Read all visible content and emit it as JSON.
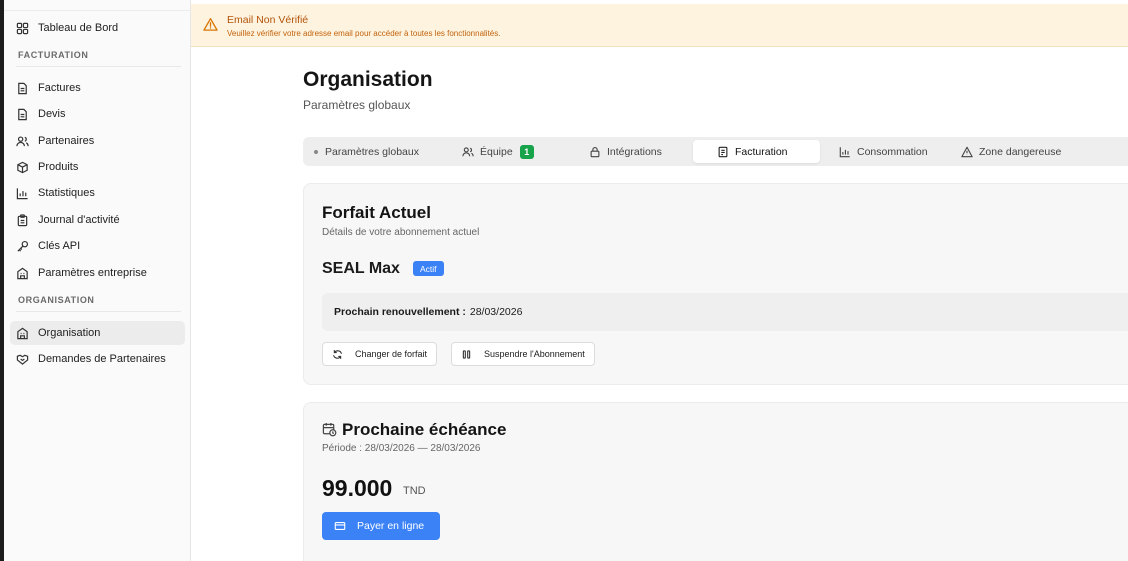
{
  "sidebar": {
    "dashboard": "Tableau de Bord",
    "section_billing": "FACTURATION",
    "items_billing": [
      "Factures",
      "Devis",
      "Partenaires",
      "Produits",
      "Statistiques",
      "Journal d'activité",
      "Clés API",
      "Paramètres entreprise"
    ],
    "section_org": "ORGANISATION",
    "items_org": [
      "Organisation",
      "Demandes de Partenaires"
    ],
    "active": "Organisation"
  },
  "banner": {
    "title": "Email Non Vérifié",
    "description": "Veuillez vérifier votre adresse email pour accéder à toutes les fonctionnalités.",
    "icon": "warning-icon"
  },
  "page": {
    "title": "Organisation",
    "subtitle": "Paramètres globaux"
  },
  "tabs": {
    "items": [
      "Paramètres globaux",
      "Équipe",
      "Intégrations",
      "Facturation",
      "Consommation",
      "Zone dangereuse"
    ],
    "team_count": "1",
    "active": "Facturation"
  },
  "plan": {
    "title": "Forfait Actuel",
    "subtitle": "Détails de votre abonnement actuel",
    "name": "SEAL Max",
    "status": "Actif",
    "renewal_label": "Prochain renouvellement :",
    "renewal_date": "28/03/2026",
    "change_button": "Changer de forfait",
    "suspend_button": "Suspendre l'Abonnement"
  },
  "due": {
    "title": "Prochaine échéance",
    "period": "Période : 28/03/2026 — 28/03/2026",
    "amount": "99.000",
    "currency": "TND",
    "pay_button": "Payer en ligne"
  },
  "colors": {
    "accent": "#3b82f6",
    "success": "#16a34a",
    "warning_bg": "#fdf3de",
    "warning_text": "#b45309"
  }
}
